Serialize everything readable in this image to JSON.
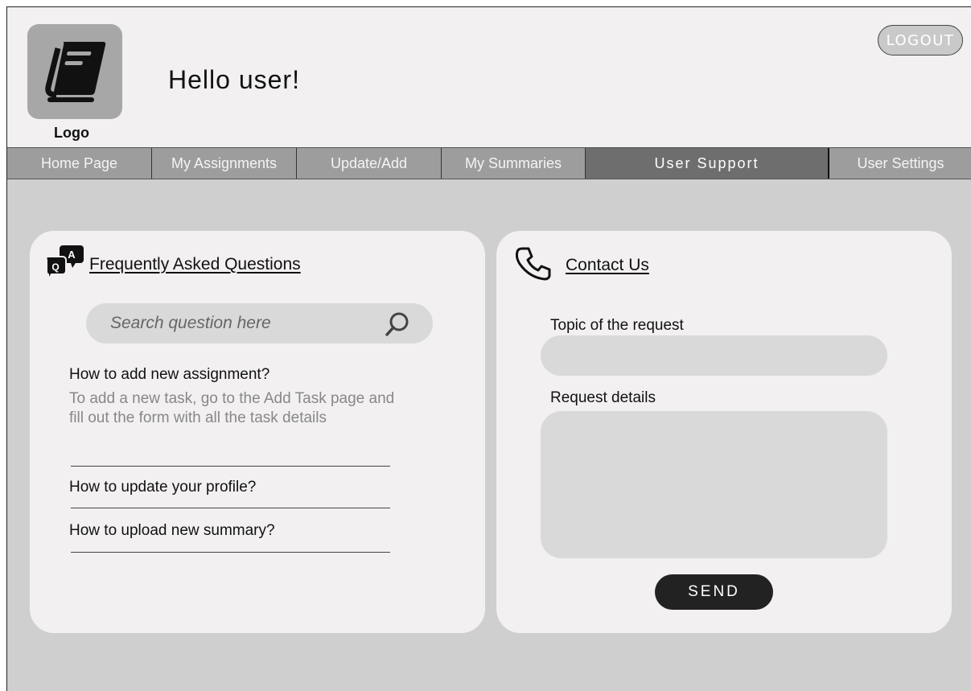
{
  "header": {
    "logo_label": "Logo",
    "greeting": "Hello user!",
    "logout_label": "LOGOUT"
  },
  "nav": {
    "items": [
      {
        "label": "Home Page"
      },
      {
        "label": "My Assignments"
      },
      {
        "label": "Update/Add"
      },
      {
        "label": "My Summaries"
      },
      {
        "label": "User Support"
      },
      {
        "label": "User Settings"
      }
    ],
    "active": "User Support"
  },
  "faq": {
    "title": "Frequently Asked Questions",
    "icon_letters": [
      "Q",
      "A"
    ],
    "search_placeholder": "Search question here",
    "items": [
      {
        "question": "How to add new assignment?",
        "answer": "To add a new task, go to the Add Task page and fill out the form with all the task details"
      },
      {
        "question": "How to update your profile?"
      },
      {
        "question": "How to upload new summary?"
      }
    ]
  },
  "contact": {
    "title": "Contact Us",
    "topic_label": "Topic of the request",
    "details_label": "Request details",
    "send_label": "SEND"
  },
  "colors": {
    "background": "#cfcfcf",
    "header": "#f2f0f1",
    "nav": "#9d9d9d",
    "nav_active": "#6e6e6e",
    "button_dark": "#222222"
  },
  "icons": {
    "logo": "book-icon",
    "faq": "qa-chat-icon",
    "search": "search-icon",
    "contact": "phone-icon"
  }
}
